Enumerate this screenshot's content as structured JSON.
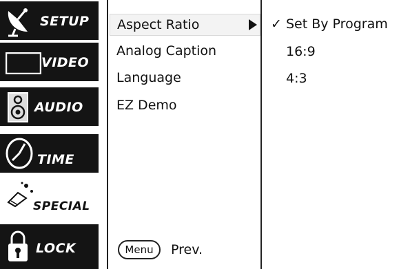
{
  "sidebar": {
    "items": [
      {
        "label": "SETUP",
        "icon": "satellite-dish-icon"
      },
      {
        "label": "VIDEO",
        "icon": "tv-screen-icon"
      },
      {
        "label": "AUDIO",
        "icon": "speaker-icon"
      },
      {
        "label": "TIME",
        "icon": "clock-icon"
      },
      {
        "label": "SPECIAL",
        "icon": "magic-wand-icon"
      },
      {
        "label": "LOCK",
        "icon": "padlock-icon"
      }
    ],
    "active": "SPECIAL"
  },
  "menu": {
    "items": [
      "Aspect Ratio",
      "Analog Caption",
      "Language",
      "EZ Demo"
    ],
    "selected": "Aspect Ratio"
  },
  "options": {
    "items": [
      "Set By Program",
      "16:9",
      "4:3"
    ],
    "checked": "Set By Program",
    "check_glyph": "✓"
  },
  "footer": {
    "menu_button": "Menu",
    "prev_label": "Prev."
  },
  "colors": {
    "sidebar_bg": "#141414",
    "active_bg": "#ffffff",
    "selection_bg": "#f3f3f3"
  }
}
